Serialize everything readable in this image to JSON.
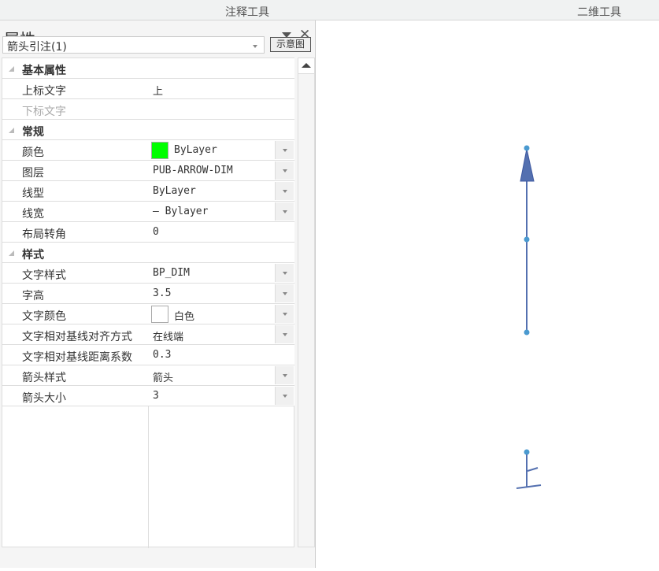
{
  "ribbon": {
    "annotation_tools": "注释工具",
    "2d_tools": "二维工具"
  },
  "panel": {
    "title": "属性",
    "selector": "箭头引注(1)",
    "preview_button": "示意图"
  },
  "grid": {
    "categories": [
      "基本属性",
      "常规",
      "样式"
    ],
    "rows": [
      {
        "name": "上标文字",
        "value": "上"
      },
      {
        "name": "下标文字",
        "value": "",
        "disabled": true
      },
      {
        "name": "颜色",
        "value": "ByLayer",
        "swatch": "#00ff00"
      },
      {
        "name": "图层",
        "value": "PUB-ARROW-DIM"
      },
      {
        "name": "线型",
        "value": "ByLayer"
      },
      {
        "name": "线宽",
        "value": "— Bylayer"
      },
      {
        "name": "布局转角",
        "value": "0"
      },
      {
        "name": "文字样式",
        "value": "BP_DIM"
      },
      {
        "name": "字高",
        "value": "3.5"
      },
      {
        "name": "文字颜色",
        "value": "白色",
        "swatch": "#ffffff"
      },
      {
        "name": "文字相对基线对齐方式",
        "value": "在线端"
      },
      {
        "name": "文字相对基线距离系数",
        "value": "0.3"
      },
      {
        "name": "箭头样式",
        "value": "箭头"
      },
      {
        "name": "箭头大小",
        "value": "3"
      }
    ]
  },
  "colors": {
    "arrow": "#5470b0",
    "grip": "#4a9ad0"
  }
}
